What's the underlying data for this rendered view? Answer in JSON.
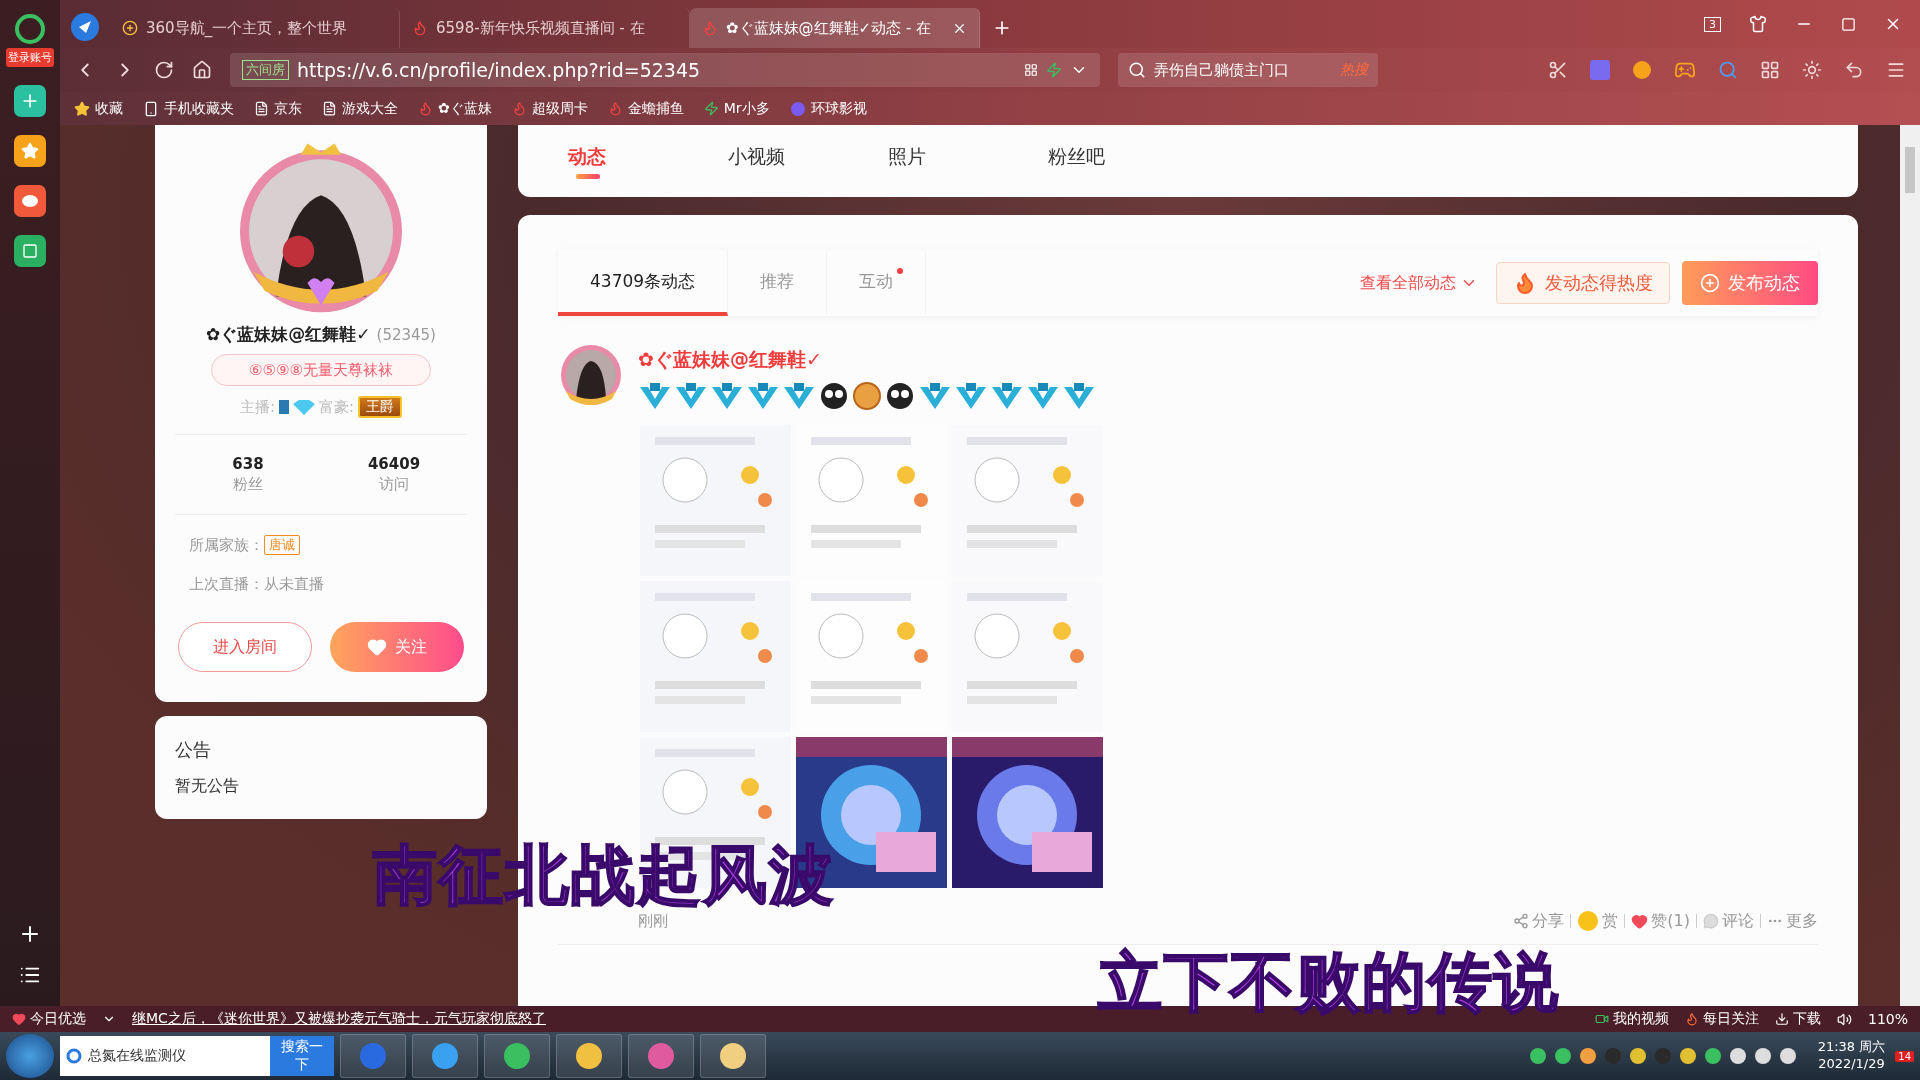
{
  "rail": {
    "login_label": "登录账号"
  },
  "browser_tabs": [
    {
      "title": "360导航_一个主页，整个世界",
      "selected": false,
      "kind": "green"
    },
    {
      "title": "6598-新年快乐视频直播间 - 在",
      "selected": false,
      "kind": "six"
    },
    {
      "title": "✿ぐ蓝妹妹@红舞鞋✓动态 - 在",
      "selected": true,
      "kind": "six"
    }
  ],
  "tab_count": "3",
  "address_bar": {
    "security_label": "六间房",
    "url": "https://v.6.cn/profile/index.php?rid=52345"
  },
  "search": {
    "value": "弄伤自己躺债主门口",
    "badge": "热搜"
  },
  "bookmarks": [
    {
      "label": "收藏",
      "kind": "star"
    },
    {
      "label": "手机收藏夹",
      "kind": "phone"
    },
    {
      "label": "京东",
      "kind": "page"
    },
    {
      "label": "游戏大全",
      "kind": "page"
    },
    {
      "label": "✿ぐ蓝妹",
      "kind": "six"
    },
    {
      "label": "超级周卡",
      "kind": "six"
    },
    {
      "label": "金蟾捕鱼",
      "kind": "six"
    },
    {
      "label": "Mr小多",
      "kind": "green"
    },
    {
      "label": "环球影视",
      "kind": "globe"
    }
  ],
  "profile": {
    "name": "✿ぐ蓝妹妹@红舞鞋✓",
    "id": "(52345)",
    "signature": "⑥⑤⑨⑧无量天尊袜袜",
    "anchor_label": "主播:",
    "wealth_label": "富豪:",
    "wealth_badge": "王爵",
    "stats": [
      {
        "value": "638",
        "label": "粉丝"
      },
      {
        "value": "46409",
        "label": "访问"
      }
    ],
    "family_label": "所属家族：",
    "family_badge": "唐诚",
    "last_live": "上次直播：从未直播",
    "buttons": [
      {
        "label": "进入房间",
        "kind": "outline"
      },
      {
        "label": "关注",
        "kind": "primary"
      }
    ]
  },
  "notice": {
    "title": "公告",
    "body": "暂无公告"
  },
  "section_tabs": [
    {
      "label": "动态",
      "selected": true
    },
    {
      "label": "小视频",
      "selected": false
    },
    {
      "label": "照片",
      "selected": false
    },
    {
      "label": "粉丝吧",
      "selected": false
    }
  ],
  "feed_tabs": [
    {
      "label": "43709条动态",
      "selected": true,
      "dot": false
    },
    {
      "label": "推荐",
      "selected": false,
      "dot": false
    },
    {
      "label": "互动",
      "selected": false,
      "dot": true
    }
  ],
  "view_all": "查看全部动态",
  "hot_button": "发动态得热度",
  "post_button": "发布动态",
  "post": {
    "author": "✿ぐ蓝妹妹@红舞鞋✓",
    "time": "刚刚",
    "actions": [
      {
        "label": "分享",
        "kind": "share"
      },
      {
        "label": "赏",
        "kind": "reward"
      },
      {
        "label": "赞(1)",
        "kind": "like"
      },
      {
        "label": "评论",
        "kind": "comment"
      },
      {
        "label": "更多",
        "kind": "more"
      }
    ]
  },
  "captions": [
    "南征北战起风波",
    "立下不败的传说"
  ],
  "status_bar": {
    "today": "今日优选",
    "news": "继MC之后，《迷你世界》又被爆抄袭元气骑士，元气玩家彻底怒了",
    "items": [
      {
        "label": "我的视频",
        "kind": "video"
      },
      {
        "label": "每日关注",
        "kind": "fire"
      },
      {
        "label": "下载",
        "kind": "download"
      }
    ],
    "zoom": "110%"
  },
  "taskbar": {
    "search_value": "总氮在线监测仪",
    "search_button": "搜索一下",
    "time": "21:38 周六",
    "date": "2022/1/29",
    "notifications": "14"
  }
}
